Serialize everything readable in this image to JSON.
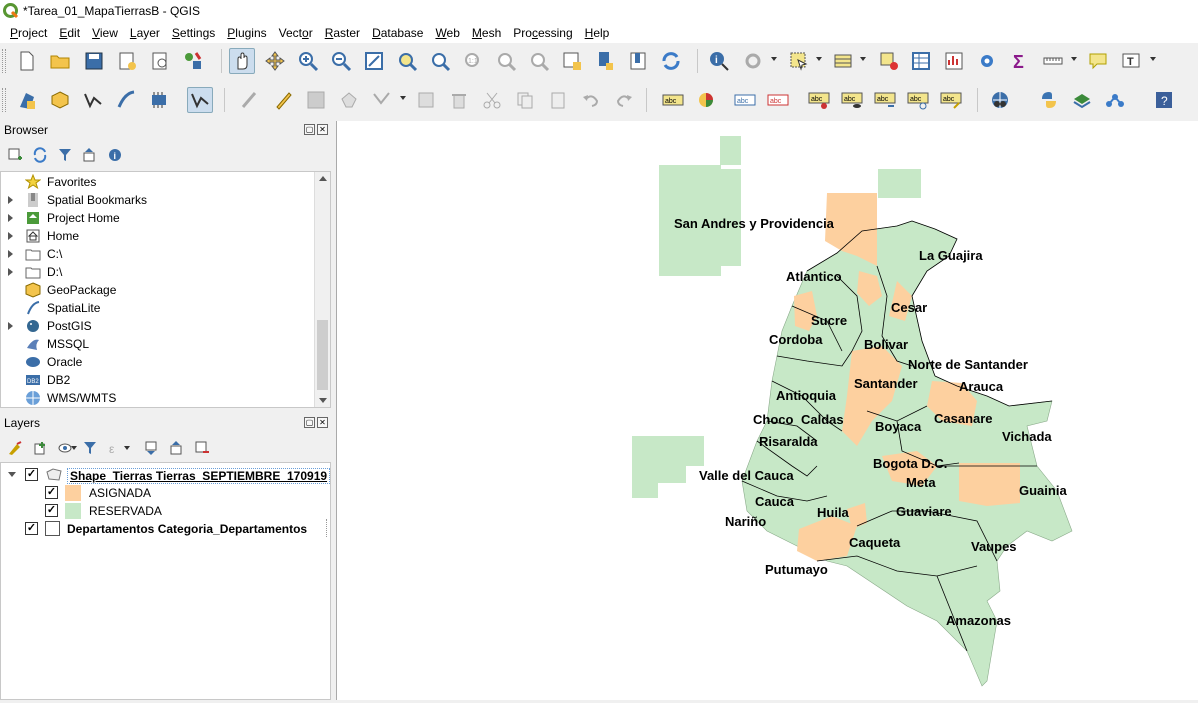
{
  "window": {
    "title": "*Tarea_01_MapaTierrasB - QGIS"
  },
  "menubar": {
    "items": [
      {
        "label": "Project",
        "u": "P"
      },
      {
        "label": "Edit",
        "u": "E"
      },
      {
        "label": "View",
        "u": "V"
      },
      {
        "label": "Layer",
        "u": "L"
      },
      {
        "label": "Settings",
        "u": "S"
      },
      {
        "label": "Plugins",
        "u": "P"
      },
      {
        "label": "Vector",
        "u": "o"
      },
      {
        "label": "Raster",
        "u": "R"
      },
      {
        "label": "Database",
        "u": "D"
      },
      {
        "label": "Web",
        "u": "W"
      },
      {
        "label": "Mesh",
        "u": "M"
      },
      {
        "label": "Processing",
        "u": "c"
      },
      {
        "label": "Help",
        "u": "H"
      }
    ]
  },
  "browser": {
    "title": "Browser",
    "items": [
      {
        "label": "Favorites",
        "icon": "star-icon",
        "expandable": false
      },
      {
        "label": "Spatial Bookmarks",
        "icon": "bookmark-icon",
        "expandable": true
      },
      {
        "label": "Project Home",
        "icon": "project-home-icon",
        "expandable": true
      },
      {
        "label": "Home",
        "icon": "home-icon",
        "expandable": true
      },
      {
        "label": "C:\\",
        "icon": "folder-icon",
        "expandable": true
      },
      {
        "label": "D:\\",
        "icon": "folder-icon",
        "expandable": true
      },
      {
        "label": "GeoPackage",
        "icon": "geopackage-icon",
        "expandable": false
      },
      {
        "label": "SpatiaLite",
        "icon": "spatialite-icon",
        "expandable": false
      },
      {
        "label": "PostGIS",
        "icon": "postgis-icon",
        "expandable": true
      },
      {
        "label": "MSSQL",
        "icon": "mssql-icon",
        "expandable": false
      },
      {
        "label": "Oracle",
        "icon": "oracle-icon",
        "expandable": false
      },
      {
        "label": "DB2",
        "icon": "db2-icon",
        "expandable": false
      },
      {
        "label": "WMS/WMTS",
        "icon": "wms-icon",
        "expandable": false
      }
    ]
  },
  "layers": {
    "title": "Layers",
    "items": [
      {
        "label": "Shape_Tierras Tierras_SEPTIEMBRE_170919",
        "checked": true,
        "type": "group"
      },
      {
        "label": "ASIGNADA",
        "checked": true,
        "color": "#fdd09f"
      },
      {
        "label": "RESERVADA",
        "checked": true,
        "color": "#c7e8c7"
      },
      {
        "label": "Departamentos Categoria_Departamentos",
        "checked": true,
        "type": "polygon"
      }
    ]
  },
  "map": {
    "colors": {
      "asignada": "#fdd09f",
      "reservada": "#c7e8c7",
      "border": "#000000",
      "background": "#ffffff"
    },
    "labels": [
      "San Andres y Providencia",
      "La Guajira",
      "Atlantico",
      "Cesar",
      "Sucre",
      "Cordoba",
      "Bolivar",
      "Norte de Santander",
      "Santander",
      "Arauca",
      "Antioquia",
      "Choco",
      "Caldas",
      "Casanare",
      "Boyaca",
      "Vichada",
      "Risaralda",
      "Bogota D.C.",
      "Valle del Cauca",
      "Meta",
      "Guainia",
      "Cauca",
      "Huila",
      "Guaviare",
      "Nariño",
      "Caqueta",
      "Vaupes",
      "Putumayo",
      "Amazonas"
    ]
  }
}
